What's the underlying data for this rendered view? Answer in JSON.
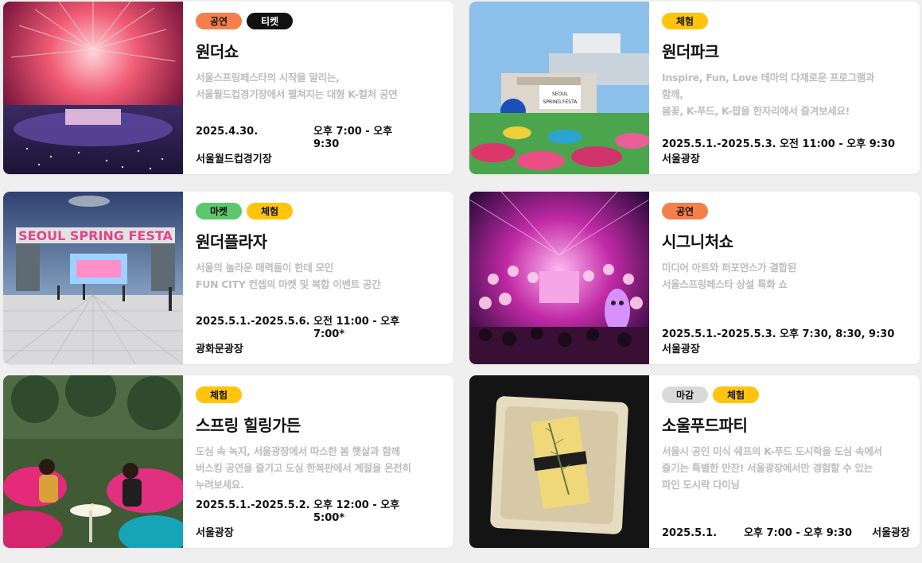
{
  "cards": [
    {
      "tags": [
        {
          "label": "공연",
          "kind": "perf"
        },
        {
          "label": "티켓",
          "kind": "ticket"
        }
      ],
      "title": "원더쇼",
      "desc": [
        "서울스프링페스타의 시작을 알리는,",
        "서울월드컵경기장에서 펼쳐지는 대형 K-컬처 공연"
      ],
      "date": "2025.4.30.",
      "time": "오후 7:00 - 오후 9:30",
      "place": "서울월드컵경기장"
    },
    {
      "tags": [
        {
          "label": "체험",
          "kind": "exp"
        }
      ],
      "title": "원더파크",
      "desc": [
        "Inspire, Fun, Love 테마의 다채로운 프로그램과",
        "함께,",
        "봄꽃, K-푸드, K-팝을 한자리에서 즐겨보세요!"
      ],
      "date": "2025.5.1.-2025.5.3.",
      "time": "오전 11:00 - 오후 9:30",
      "place": "서울광장",
      "sign": [
        "SEOUL",
        "SPRING FESTA"
      ]
    },
    {
      "tags": [
        {
          "label": "마켓",
          "kind": "market"
        },
        {
          "label": "체험",
          "kind": "exp"
        }
      ],
      "title": "원더플라자",
      "desc": [
        "서울의 놀라운 매력들이 한데 모인",
        "FUN CITY 컨셉의 마켓 및 복합 이벤트 공간"
      ],
      "date": "2025.5.1.-2025.5.6.",
      "time": "오전 11:00 - 오후 7:00*",
      "place": "광화문광장",
      "sign": "SEOUL SPRING FESTA"
    },
    {
      "tags": [
        {
          "label": "공연",
          "kind": "perf"
        }
      ],
      "title": "시그니처쇼",
      "desc": [
        "미디어 아트와 퍼포먼스가 결합된",
        "서울스프링페스타 상설 특화 쇼"
      ],
      "date": "2025.5.1.-2025.5.3.",
      "time": "오후 7:30, 8:30, 9:30",
      "place": "서울광장"
    },
    {
      "tags": [
        {
          "label": "체험",
          "kind": "exp"
        }
      ],
      "title": "스프링 힐링가든",
      "desc": [
        "도심 속 녹지, 서울광장에서 따스한 봄 햇살과 함께",
        "버스킹 공연을 즐기고 도심 한복판에서 계절을 온전히",
        "누려보세요."
      ],
      "date": "2025.5.1.-2025.5.2.",
      "time": "오후 12:00 - 오후 5:00*",
      "place": "서울광장"
    },
    {
      "tags": [
        {
          "label": "마감",
          "kind": "closed"
        },
        {
          "label": "체험",
          "kind": "exp"
        }
      ],
      "title": "소울푸드파티",
      "desc": [
        "서울시 공인 미식 쉐프의 K-푸드 도시락을 도심 속에서",
        "즐기는 특별한 만찬! 서울광장에서만 경험할 수 있는",
        "파인 도시락 다이닝"
      ],
      "date": "2025.5.1.",
      "time": "오후 7:00 - 오후 9:30",
      "place": "서울광장"
    }
  ]
}
